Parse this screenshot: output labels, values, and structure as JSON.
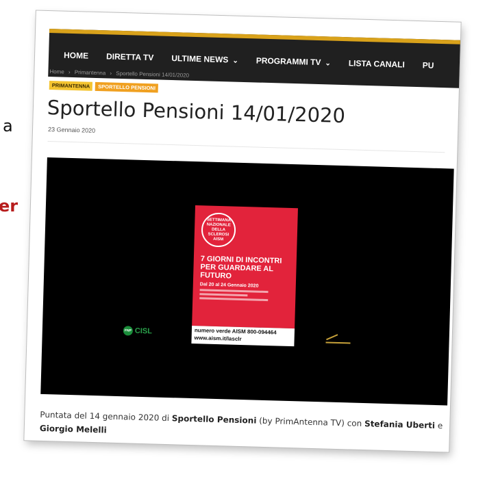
{
  "edge_text": {
    "fragment_a": "a",
    "fragment_er": "er"
  },
  "nav": {
    "items": [
      {
        "label": "HOME"
      },
      {
        "label": "DIRETTA TV"
      },
      {
        "label": "ULTIME NEWS"
      },
      {
        "label": "PROGRAMMI TV"
      },
      {
        "label": "LISTA CANALI"
      },
      {
        "label": "PU"
      }
    ],
    "chevron": "⌄",
    "accent_color": "#d9a21b",
    "bar_color": "#202020"
  },
  "breadcrumb": {
    "home": "Home",
    "sep": "›",
    "section": "Primantenna",
    "current": "Sportello Pensioni 14/01/2020"
  },
  "tags": {
    "tag1": "PRIMANTENNA",
    "tag2": "SPORTELLO PENSIONI"
  },
  "article": {
    "title": "Sportello Pensioni 14/01/2020",
    "date": "23 Gennaio 2020"
  },
  "video_frame": {
    "badge": {
      "line1": "SETTIMANA",
      "line2": "NAZIONALE",
      "line3": "DELLA SCLEROSI",
      "line4": "AISM"
    },
    "headline1": "7 GIORNI DI INCONTRI",
    "headline2": "PER GUARDARE AL FUTURO",
    "dates": "Dal 20 al 24 Gennaio 2020",
    "phone": "numero verde AISM 800-094464",
    "url": "www.aism.it/lasclr",
    "logo_left": "CISL",
    "logo_left_badge": "FNP",
    "poster_color": "#e2233b"
  },
  "caption": {
    "p1": "Puntata del 14 gennaio 2020 di ",
    "b1": "Sportello Pensioni",
    "p2": " (by PrimAntenna TV) con ",
    "b2": "Stefania Uberti",
    "p3": " e ",
    "b3": "Giorgio Melelli"
  }
}
